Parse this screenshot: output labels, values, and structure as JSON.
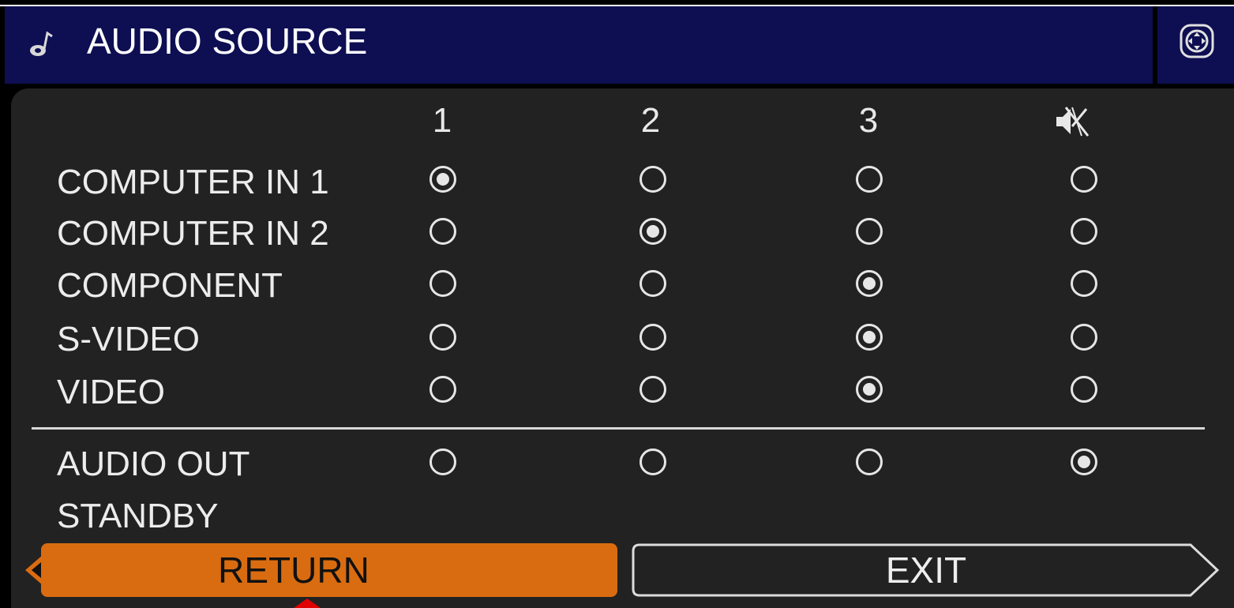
{
  "window": {
    "title": "AUDIO SOURCE",
    "title_icon": "music-note-icon",
    "corner_icon": "navigate-icon"
  },
  "columns": [
    {
      "label": "1"
    },
    {
      "label": "2"
    },
    {
      "label": "3"
    },
    {
      "label": "",
      "icon": "mute-icon"
    }
  ],
  "rows": [
    {
      "label": "COMPUTER IN 1",
      "selected_column": 1
    },
    {
      "label": "COMPUTER IN 2",
      "selected_column": 2
    },
    {
      "label": "COMPONENT",
      "selected_column": 3
    },
    {
      "label": "S-VIDEO",
      "selected_column": 3
    },
    {
      "label": "VIDEO",
      "selected_column": 3
    },
    {
      "label": "AUDIO OUT",
      "selected_column": 4
    }
  ],
  "standby_label": "STANDBY",
  "buttons": {
    "return_label": "RETURN",
    "exit_label": "EXIT"
  },
  "colors": {
    "title_bar": "#0e0e52",
    "panel": "#222222",
    "return_button": "#d96c10",
    "pointer": "#e00000"
  }
}
